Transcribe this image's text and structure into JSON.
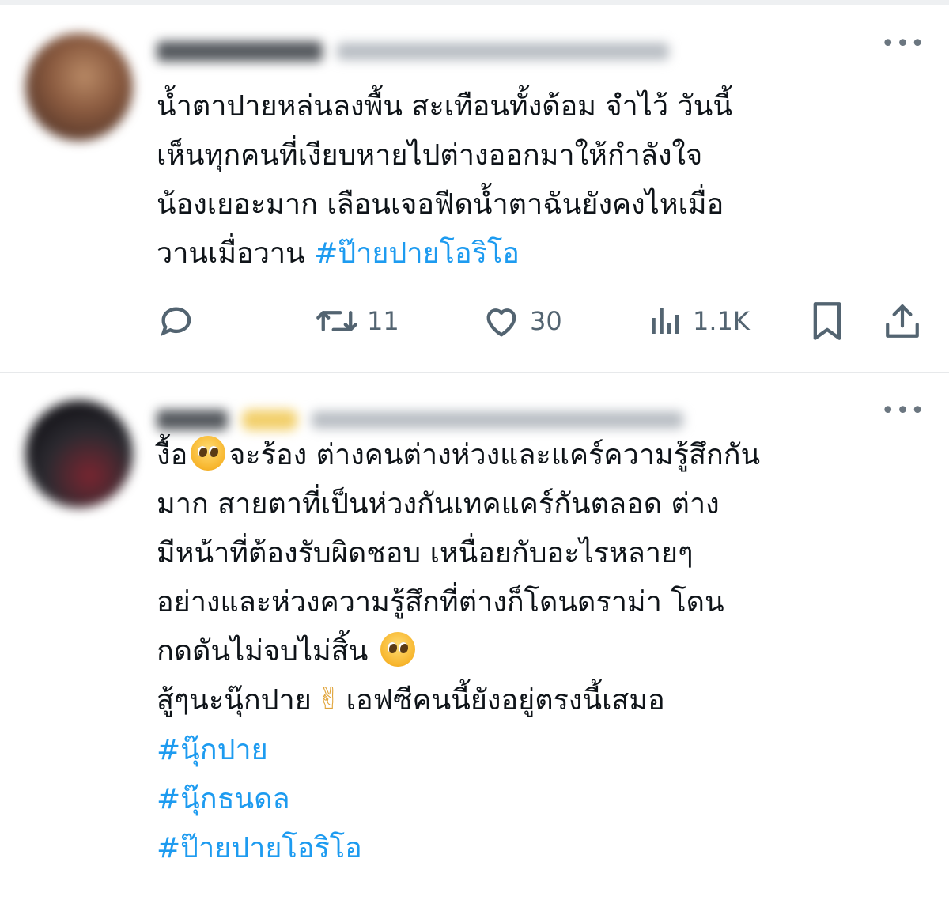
{
  "tweets": [
    {
      "author_blurred": true,
      "more_label": "•••",
      "lines": [
        "น้ำตาปายหล่นลงพื้น สะเทือนทั้งด้อม จำไว้ วันนี้",
        "เห็นทุกคนที่เงียบหายไปต่างออกมาให้กำลังใจ",
        "น้องเยอะมาก เลือนเจอฟีดน้ำตาฉันยังคงไหเมื่อ"
      ],
      "last_line_text": "วานเมื่อวาน ",
      "last_line_hashtag": "#ป๊ายปายโอริโอ",
      "actions": {
        "reply_icon": "reply-icon",
        "retweet_icon": "retweet-icon",
        "retweet_count": "11",
        "like_icon": "heart-icon",
        "like_count": "30",
        "views_icon": "analytics-icon",
        "views_count": "1.1K",
        "bookmark_icon": "bookmark-icon",
        "share_icon": "share-icon"
      }
    },
    {
      "author_blurred": true,
      "more_label": "•••",
      "line1_a": "งื้อ",
      "line1_b": "จะร้อง ต่างคนต่างห่วงและแคร์ความรู้สึกกัน",
      "lines": [
        "มาก สายตาที่เป็นห่วงกันเทคแคร์กันตลอด ต่าง",
        "มีหน้าที่ต้องรับผิดชอบ เหนื่อยกับอะไรหลายๆ",
        "อย่างและห่วงความรู้สึกที่ต่างก็โดนดราม่า โดน"
      ],
      "line5": "กดดันไม่จบไม่สิ้น",
      "line6_a": "สู้ๆนะนุ๊กปาย",
      "line6_b": "เอฟซีคนนี้ยังอยู่ตรงนี้เสมอ",
      "hashtags": [
        "#นุ๊กปาย",
        "#นุ๊กธนดล",
        "#ป๊ายปายโอริโอ"
      ],
      "emoji_pleading": "pleading-face-emoji",
      "emoji_victory": "✌"
    }
  ],
  "colors": {
    "hashtag": "#1d9bf0",
    "icon_gray": "#536471",
    "text": "#0f1419"
  }
}
